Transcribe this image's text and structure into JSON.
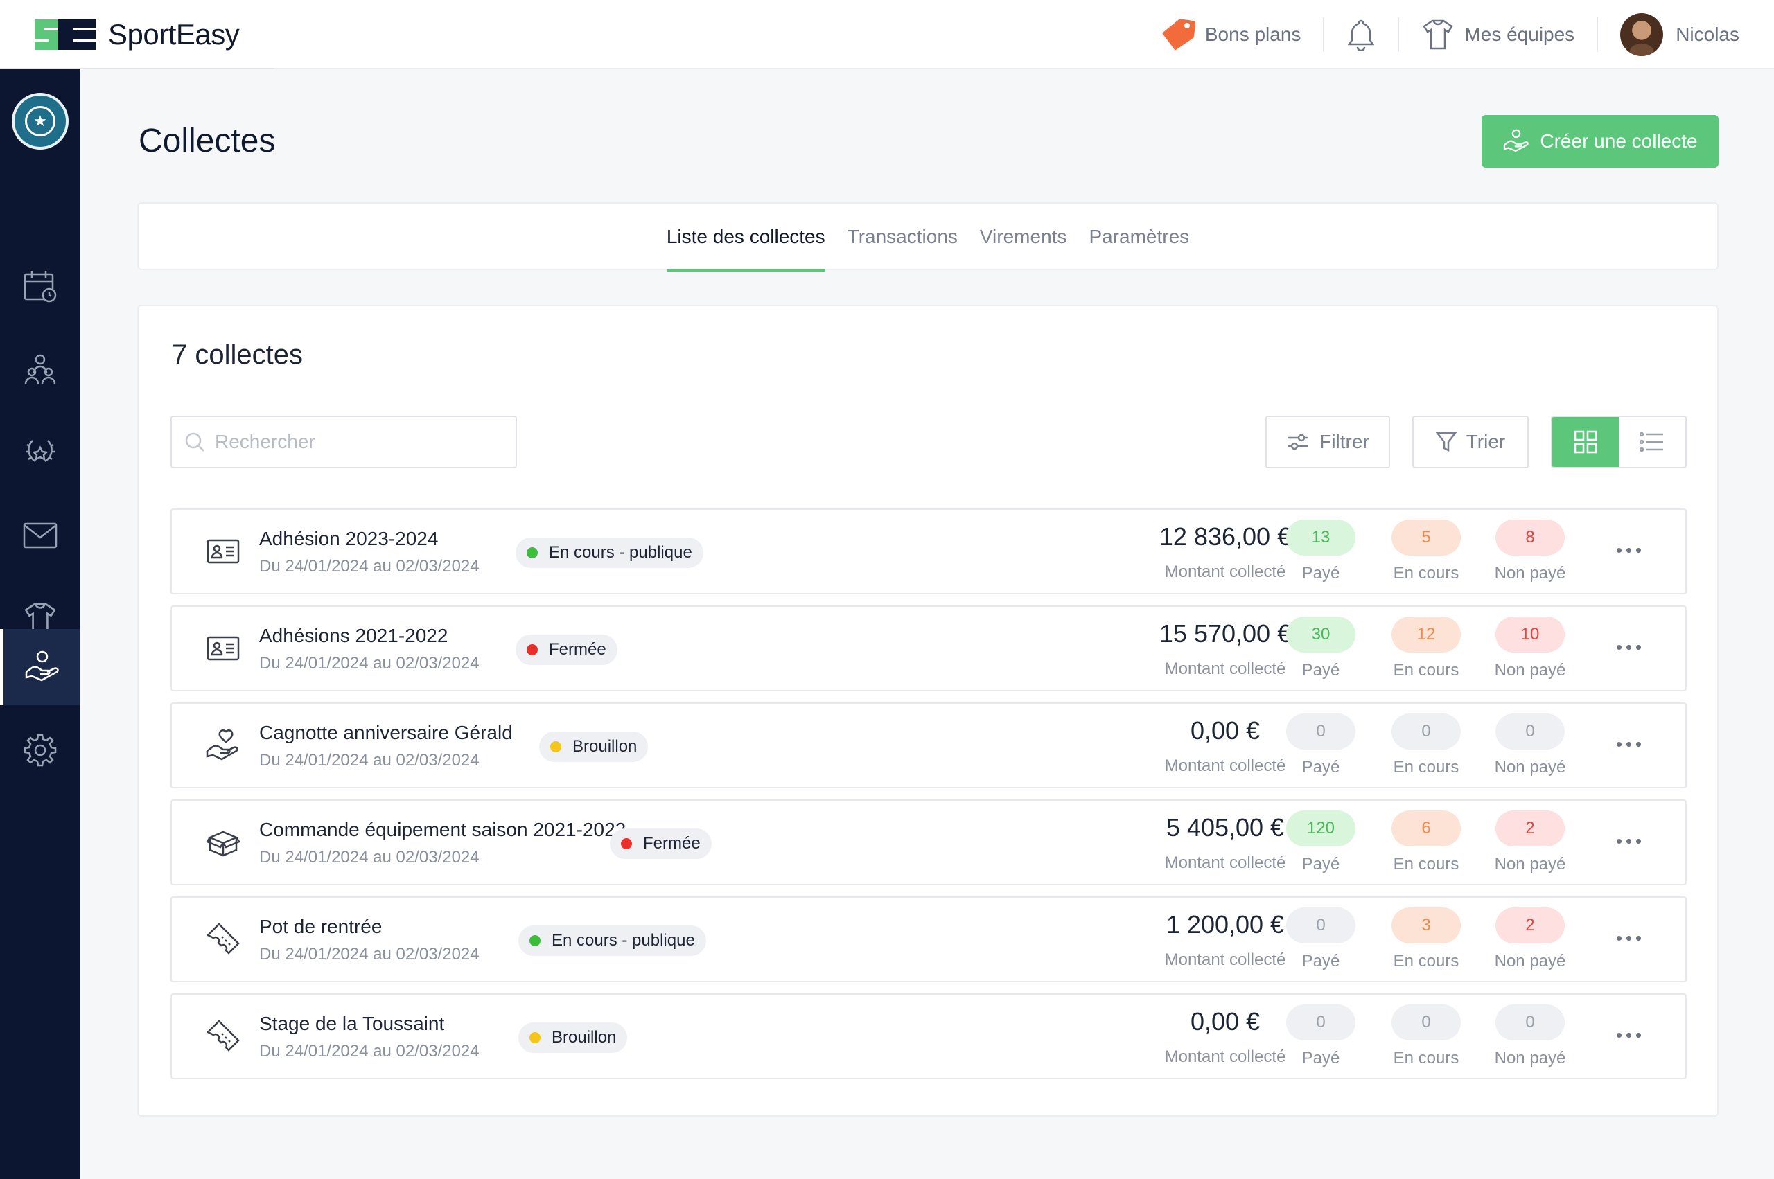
{
  "app": {
    "brand_mark": "SE",
    "brand_name": "SportEasy"
  },
  "topbar": {
    "deals_label": "Bons plans",
    "teams_label": "Mes équipes",
    "user_name": "Nicolas"
  },
  "page": {
    "title": "Collectes",
    "create_label": "Créer une collecte"
  },
  "tabs": [
    {
      "label": "Liste des collectes",
      "active": true
    },
    {
      "label": "Transactions",
      "active": false
    },
    {
      "label": "Virements",
      "active": false
    },
    {
      "label": "Paramètres",
      "active": false
    }
  ],
  "list": {
    "count_title": "7 collectes",
    "search_placeholder": "Rechercher",
    "filter_label": "Filtrer",
    "sort_label": "Trier"
  },
  "labels": {
    "amount_caption": "Montant collecté",
    "paid": "Payé",
    "in_progress": "En cours",
    "unpaid": "Non payé"
  },
  "colors": {
    "accent": "#5cc77b",
    "sidebar": "#0c1631",
    "status_open": "#3bbf3b",
    "status_closed": "#e8302a",
    "status_draft": "#f5c518"
  },
  "collections": [
    {
      "icon": "id-card-icon",
      "name": "Adhésion 2023-2024",
      "dates": "Du 24/01/2024 au 02/03/2024",
      "status": "En cours - publique",
      "status_kind": "open",
      "amount": "12 836,00 €",
      "paid": "13",
      "in_progress": "5",
      "unpaid": "8"
    },
    {
      "icon": "id-card-icon",
      "name": "Adhésions 2021-2022",
      "dates": "Du 24/01/2024 au 02/03/2024",
      "status": "Fermée",
      "status_kind": "closed",
      "amount": "15 570,00 €",
      "paid": "30",
      "in_progress": "12",
      "unpaid": "10"
    },
    {
      "icon": "heart-hand-icon",
      "name": "Cagnotte anniversaire Gérald",
      "dates": "Du 24/01/2024 au 02/03/2024",
      "status": "Brouillon",
      "status_kind": "draft",
      "amount": "0,00 €",
      "paid": "0",
      "in_progress": "0",
      "unpaid": "0"
    },
    {
      "icon": "box-icon",
      "name": "Commande équipement saison 2021-2022",
      "dates": "Du 24/01/2024 au 02/03/2024",
      "status": "Fermée",
      "status_kind": "closed",
      "amount": "5 405,00 €",
      "paid": "120",
      "in_progress": "6",
      "unpaid": "2"
    },
    {
      "icon": "ticket-icon",
      "name": "Pot de rentrée",
      "dates": "Du 24/01/2024 au 02/03/2024",
      "status": "En cours - publique",
      "status_kind": "open",
      "amount": "1 200,00 €",
      "paid": "0",
      "in_progress": "3",
      "unpaid": "2"
    },
    {
      "icon": "ticket-icon",
      "name": "Stage de la Toussaint",
      "dates": "Du 24/01/2024 au 02/03/2024",
      "status": "Brouillon",
      "status_kind": "draft",
      "amount": "0,00 €",
      "paid": "0",
      "in_progress": "0",
      "unpaid": "0"
    }
  ]
}
